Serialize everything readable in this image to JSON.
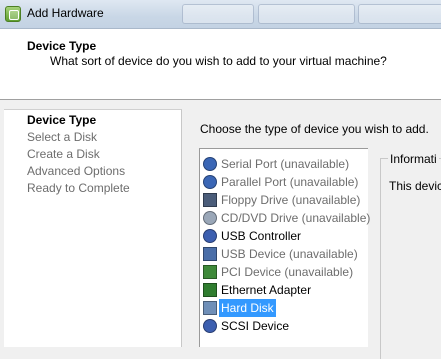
{
  "window": {
    "title": "Add Hardware"
  },
  "header": {
    "title": "Device Type",
    "subtitle": "What sort of device do you wish to add to your virtual machine?"
  },
  "steps": [
    {
      "label": "Device Type",
      "current": true
    },
    {
      "label": "Select a Disk",
      "current": false
    },
    {
      "label": "Create a Disk",
      "current": false
    },
    {
      "label": "Advanced Options",
      "current": false
    },
    {
      "label": "Ready to Complete",
      "current": false
    }
  ],
  "main": {
    "prompt": "Choose the type of device you wish to add.",
    "devices": [
      {
        "label": "Serial Port (unavailable)",
        "icon": "serial-port-icon",
        "available": false,
        "color": "#3a66b5"
      },
      {
        "label": "Parallel Port (unavailable)",
        "icon": "parallel-port-icon",
        "available": false,
        "color": "#3a66b5"
      },
      {
        "label": "Floppy Drive (unavailable)",
        "icon": "floppy-drive-icon",
        "available": false,
        "color": "#4b5d7a"
      },
      {
        "label": "CD/DVD Drive (unavailable)",
        "icon": "cd-dvd-drive-icon",
        "available": false,
        "color": "#9aa7b8"
      },
      {
        "label": "USB Controller",
        "icon": "usb-controller-icon",
        "available": true,
        "color": "#3c5fb0"
      },
      {
        "label": "USB Device (unavailable)",
        "icon": "usb-device-icon",
        "available": false,
        "color": "#4a6ea8"
      },
      {
        "label": "PCI Device (unavailable)",
        "icon": "pci-device-icon",
        "available": false,
        "color": "#3f8a3a"
      },
      {
        "label": "Ethernet Adapter",
        "icon": "ethernet-adapter-icon",
        "available": true,
        "color": "#2f7d2f"
      },
      {
        "label": "Hard Disk",
        "icon": "hard-disk-icon",
        "available": true,
        "selected": true,
        "color": "#6f8fb8"
      },
      {
        "label": "SCSI Device",
        "icon": "scsi-device-icon",
        "available": true,
        "color": "#3c5fb0"
      }
    ],
    "information": {
      "title": "Informati",
      "text": "This devic"
    }
  }
}
